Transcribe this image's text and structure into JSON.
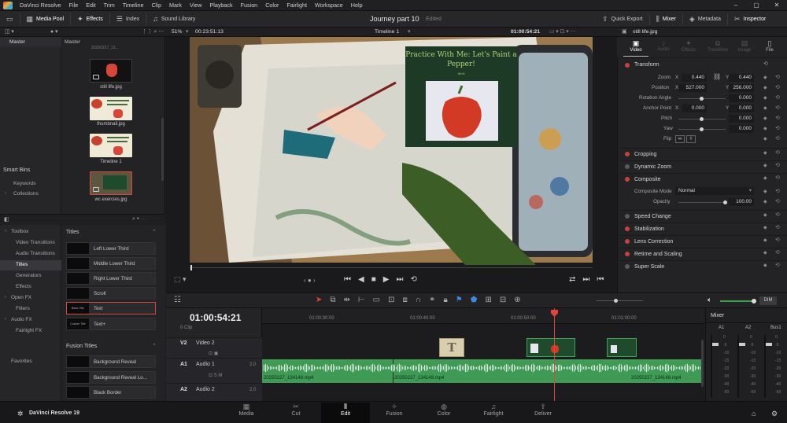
{
  "menubar": {
    "app_name": "DaVinci Resolve",
    "items": [
      "File",
      "Edit",
      "Trim",
      "Timeline",
      "Clip",
      "Mark",
      "View",
      "Playback",
      "Fusion",
      "Color",
      "Fairlight",
      "Workspace",
      "Help"
    ]
  },
  "toolbar": {
    "media_pool": "Media Pool",
    "effects": "Effects",
    "index": "Index",
    "sound_library": "Sound Library",
    "project_title": "Journey part 10",
    "project_status": "Edited",
    "quick_export": "Quick Export",
    "mixer": "Mixer",
    "metadata": "Metadata",
    "inspector": "Inspector"
  },
  "viewer_bar": {
    "zoom": "51%",
    "source_timecode": "00:23:51:13",
    "timeline_name": "Timeline 1",
    "record_timecode": "01:00:54:21",
    "clip_name": "still life.jpg"
  },
  "media_pool": {
    "bin_header": "Master",
    "content_header": "Master",
    "top_clip_caption": "20250227_13...",
    "clips": [
      {
        "name": "still life.jpg"
      },
      {
        "name": "thumbnail.jpg"
      },
      {
        "name": "Timeline 1"
      },
      {
        "name": "wc exercies.jpg"
      }
    ],
    "smart_bins": "Smart Bins",
    "smart_items": [
      "Keywords",
      "Collections"
    ]
  },
  "effects": {
    "tree": [
      {
        "label": "Toolbox",
        "level": 0
      },
      {
        "label": "Video Transitions",
        "level": 1
      },
      {
        "label": "Audio Transitions",
        "level": 1
      },
      {
        "label": "Titles",
        "level": 1,
        "selected": true
      },
      {
        "label": "Generators",
        "level": 1
      },
      {
        "label": "Effects",
        "level": 1
      },
      {
        "label": "Open FX",
        "level": 0
      },
      {
        "label": "Filters",
        "level": 1
      },
      {
        "label": "Audio FX",
        "level": 0
      },
      {
        "label": "Fairlight FX",
        "level": 1
      }
    ],
    "favorites": "Favorites",
    "titles_header": "Titles",
    "titles": [
      "Left Lower Third",
      "Middle Lower Third",
      "Right Lower Third",
      "Scroll",
      "Text",
      "Text+"
    ],
    "title_thumb_labels": [
      "Basic Title",
      "Custom Title"
    ],
    "fusion_header": "Fusion Titles",
    "fusion_titles": [
      "Background Reveal",
      "Background Reveal Lo...",
      "Black Border"
    ]
  },
  "viewer_content": {
    "overlay_title": "Practice With Me: Let's Paint a Pepper!",
    "overlay_small": "Sk+k"
  },
  "inspector": {
    "tabs": [
      "Video",
      "Audio",
      "Effects",
      "Transition",
      "Image",
      "File"
    ],
    "transform": "Transform",
    "zoom_label": "Zoom",
    "zoom_x": "0.440",
    "zoom_y": "0.440",
    "position_label": "Position",
    "pos_x": "527.000",
    "pos_y": "256.000",
    "rotation_label": "Rotation Angle",
    "rotation": "0.000",
    "anchor_label": "Anchor Point",
    "anchor_x": "0.000",
    "anchor_y": "0.000",
    "pitch_label": "Pitch",
    "pitch": "0.000",
    "yaw_label": "Yaw",
    "yaw": "0.000",
    "flip_label": "Flip",
    "x": "X",
    "y": "Y",
    "cropping": "Cropping",
    "dynamic_zoom": "Dynamic Zoom",
    "composite": "Composite",
    "composite_mode_label": "Composite Mode",
    "composite_mode": "Normal",
    "opacity_label": "Opacity",
    "opacity": "100.00",
    "speed_change": "Speed Change",
    "stabilization": "Stabilization",
    "lens_correction": "Lens Correction",
    "retime": "Retime and Scaling",
    "super_scale": "Super Scale"
  },
  "timeline": {
    "timecode": "01:00:54:21",
    "clip_count": "0 Clip",
    "ruler": [
      "01:00:30:00",
      "01:00:40:00",
      "01:00:50:00",
      "01:01:00:00"
    ],
    "tracks": [
      {
        "id": "V2",
        "name": "Video 2"
      },
      {
        "id": "A1",
        "name": "Audio 1",
        "level": "2.0"
      },
      {
        "id": "A2",
        "name": "Audio 2",
        "level": "2.0"
      }
    ],
    "audio_clips": [
      "20250227_134148.mp4",
      "20250227_134148.mp4",
      "20250227_134148.mp4"
    ],
    "title_clip_letter": "T",
    "dim": "DIM"
  },
  "mixer": {
    "title": "Mixer",
    "channels": [
      "A1",
      "A2",
      "Bus1"
    ],
    "scale": [
      "0",
      "-5",
      "-10",
      "-15",
      "-20",
      "-30",
      "-40",
      "-50"
    ]
  },
  "pagebar": {
    "product": "DaVinci Resolve 19",
    "pages": [
      "Media",
      "Cut",
      "Edit",
      "Fusion",
      "Color",
      "Fairlight",
      "Deliver"
    ],
    "active": "Edit"
  },
  "colors": {
    "accent_red": "#c6413b",
    "audio_clip_green": "#3e9a55",
    "playhead": "#e0443b",
    "overlay_green": "#1d3a26"
  }
}
